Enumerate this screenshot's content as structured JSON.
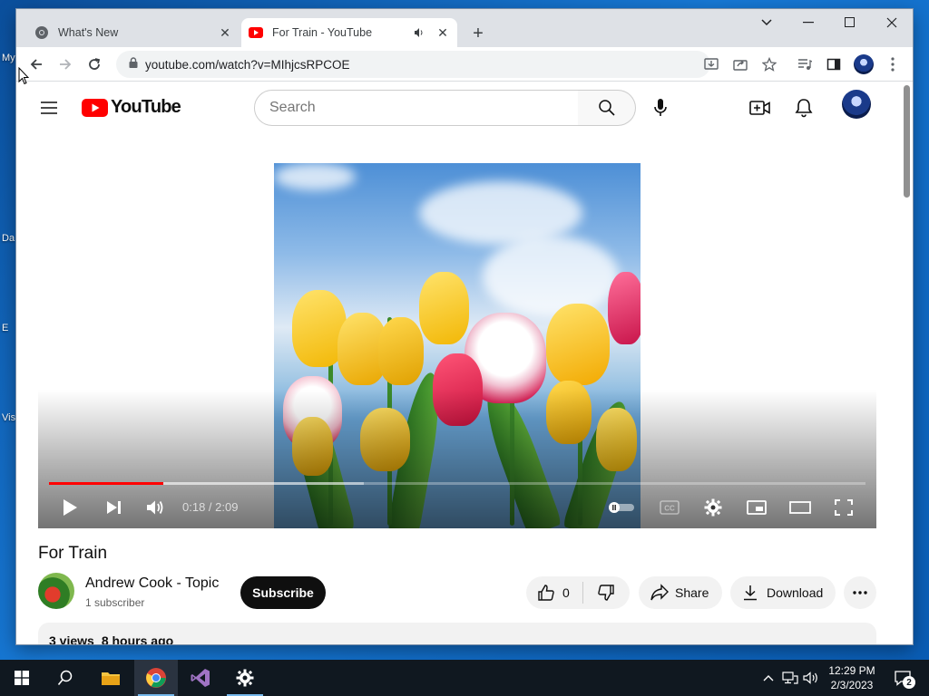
{
  "desktop": {
    "labels": [
      "My",
      "Da",
      "E",
      "Vis"
    ]
  },
  "browser": {
    "tabs": [
      {
        "title": "What's New",
        "active": false,
        "favicon": "chrome-icon"
      },
      {
        "title": "For Train - YouTube",
        "active": true,
        "favicon": "youtube-icon",
        "audio": true
      }
    ],
    "url": "youtube.com/watch?v=MIhjcsRPCOE"
  },
  "youtube": {
    "logo_text": "YouTube",
    "search_placeholder": "Search"
  },
  "player": {
    "time_current": "0:18",
    "time_total": "2:09",
    "time_display": "0:18 / 2:09",
    "progress_played": 0.14,
    "progress_loaded": 0.385,
    "progress_color": "#ff0000"
  },
  "video": {
    "title": "For Train",
    "channel": "Andrew Cook - Topic",
    "subscribers": "1 subscriber",
    "subscribe_label": "Subscribe",
    "likes": "0",
    "share_label": "Share",
    "download_label": "Download",
    "views": "3 views",
    "uploaded": "8 hours ago"
  },
  "taskbar": {
    "time": "12:29 PM",
    "date": "2/3/2023",
    "notifications": "2",
    "accent": "#76b9ed"
  }
}
